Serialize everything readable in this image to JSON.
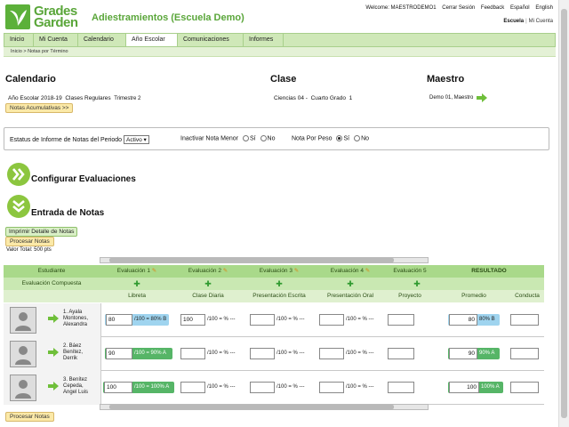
{
  "header": {
    "logo_line1": "Grades",
    "logo_line2": "Garden",
    "site_title": "Adiestramientos (Escuela Demo)",
    "toplinks": [
      "Welcome: MAESTRODEMO1",
      "Cerrar Sesión",
      "Feedback",
      "Español",
      "English"
    ],
    "school_label": "Escuela",
    "my_account": "Mi Cuenta"
  },
  "nav": {
    "items": [
      "Inicio",
      "Mi Cuenta",
      "Calendario",
      "Año Escolar",
      "Comunicaciones",
      "Informes"
    ],
    "active": "Año Escolar"
  },
  "breadcrumb": [
    "Inicio",
    ">",
    "Notas por Término"
  ],
  "calendario": {
    "title": "Calendario",
    "year": "Año Escolar 2018-19",
    "type": "Clases Regulares",
    "term": "Trimestre 2",
    "cumulative_button": "Notas Acumulativas >>"
  },
  "clase": {
    "title": "Clase",
    "subject": "Ciencias 04 -",
    "grade": "Cuarto Grado",
    "section": "1"
  },
  "maestro": {
    "title": "Maestro",
    "name": "Demo 01, Maestro"
  },
  "status": {
    "label": "Estatus de Informe de Notas del Periodo",
    "selected": "Activo",
    "inactivate_label": "Inactivar Nota Menor",
    "si": "Sí",
    "no": "No",
    "weight_label": "Nota Por Peso",
    "inactivate_value": "none",
    "weight_value": "Sí"
  },
  "sections": {
    "configure": "Configurar Evaluaciones",
    "entry": "Entrada de Notas"
  },
  "actions": {
    "print": "Imprimir Detalle de Notas",
    "process": "Procesar Notas",
    "total": "Valor Total: 500 pts"
  },
  "table": {
    "col_student": "Estudiante",
    "col_composite": "Evaluación Compuesta",
    "col_result": "RESULTADO",
    "evaluations": [
      "Evaluación 1",
      "Evaluación 2",
      "Evaluación 3",
      "Evaluación 4",
      "Evaluación 5"
    ],
    "categories": [
      "Libreta",
      "Clase Diaria",
      "Presentación Escrita",
      "Presentación Oral",
      "Proyecto"
    ],
    "result_cols": [
      "Promedio",
      "Conducta"
    ],
    "rows": [
      {
        "name_line1": "1. Ayala",
        "name_line2": "Montones,",
        "name_line3": "Alexandra",
        "g1": "80",
        "g1_text": "/100 = 80% B",
        "g2": "100",
        "g2_text": "/100 = % ---",
        "g3": "",
        "g3_text": "/100 = % ---",
        "g4": "",
        "g4_text": "/100 = % ---",
        "g5": "",
        "g5_text": "",
        "avg": "80",
        "avg_text": "80% B",
        "conduct": ""
      },
      {
        "name_line1": "2. Báez",
        "name_line2": "Benítez,",
        "name_line3": "Derrik",
        "g1": "90",
        "g1_text": "/100 = 90% A",
        "g2": "",
        "g2_text": "/100 = % ---",
        "g3": "",
        "g3_text": "/100 = % ---",
        "g4": "",
        "g4_text": "/100 = % ---",
        "g5": "",
        "g5_text": "",
        "avg": "90",
        "avg_text": "90% A",
        "conduct": ""
      },
      {
        "name_line1": "3. Benítez",
        "name_line2": "Cepeda,",
        "name_line3": "Angel Luis",
        "g1": "100",
        "g1_text": "/100 = 100% A",
        "g2": "",
        "g2_text": "/100 = % ---",
        "g3": "",
        "g3_text": "/100 = % ---",
        "g4": "",
        "g4_text": "/100 = % ---",
        "g5": "",
        "g5_text": "",
        "avg": "100",
        "avg_text": "100% A",
        "conduct": ""
      }
    ]
  },
  "colors": {
    "brand_green": "#5aa63a",
    "header_green": "#a9d98a",
    "blue_grade": "#9fd4ef",
    "green_grade": "#56b567"
  },
  "icons": [
    "logo-leaf-icon",
    "arrow-right-icon",
    "pencil-icon",
    "plus-icon",
    "chevron-double-right-icon",
    "chevron-double-down-icon",
    "avatar-icon"
  ]
}
